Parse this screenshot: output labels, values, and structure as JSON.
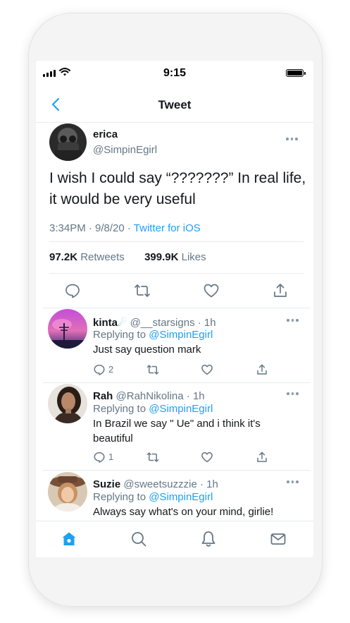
{
  "status": {
    "time": "9:15"
  },
  "nav": {
    "title": "Tweet"
  },
  "tweet": {
    "name": "erica",
    "handle": "@SimpinEgirl",
    "text": "I wish I could say “???????” In real life, it would be very useful",
    "time": "3:34PM · 9/8/20 · ",
    "source": "Twitter for iOS",
    "retweets_count": "97.2K",
    "retweets_label": "Retweets",
    "likes_count": "399.9K",
    "likes_label": "Likes"
  },
  "replies": [
    {
      "name": "kinta",
      "handle": "@__starsigns",
      "time": "· 1h",
      "replying_label": "Replying to",
      "replying_to": "@SimpinEgirl",
      "text": "Just say question mark",
      "reply_count": "2"
    },
    {
      "name": "Rah",
      "handle": "@RahNikolina",
      "time": "· 1h",
      "replying_label": "Replying to",
      "replying_to": "@SimpinEgirl",
      "text": "In Brazil we say \" Ue\" and i think it's beautiful",
      "reply_count": "1"
    },
    {
      "name": "Suzie",
      "handle": "@sweetsuzzzie",
      "time": "· 1h",
      "replying_label": "Replying to",
      "replying_to": "@SimpinEgirl",
      "text": "Always say what's on your mind, girlie!",
      "reply_count": ""
    }
  ],
  "colors": {
    "accent": "#1da1f2",
    "secondary_text": "#657786",
    "divider": "#e6ecf0"
  },
  "icons": [
    "back-chevron-icon",
    "more-icon",
    "reply-icon",
    "retweet-icon",
    "like-icon",
    "share-icon",
    "home-icon",
    "search-icon",
    "notifications-icon",
    "messages-icon"
  ]
}
